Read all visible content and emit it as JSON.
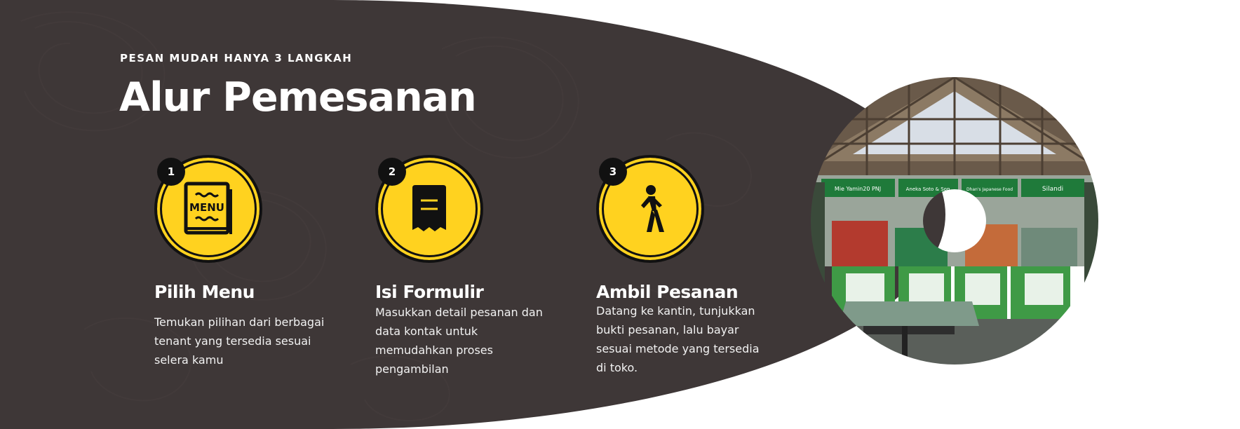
{
  "eyebrow": "PESAN MUDAH HANYA 3 LANGKAH",
  "title": "Alur Pemesanan",
  "colors": {
    "panel": "#3e3737",
    "accent": "#ffd21f",
    "ink": "#111111",
    "text": "#ffffff"
  },
  "steps": [
    {
      "number": "1",
      "icon": "menu-book-icon",
      "icon_text": "MENU",
      "title": "Pilih Menu",
      "description": "Temukan pilihan dari berbagai tenant yang tersedia sesuai selera kamu"
    },
    {
      "number": "2",
      "icon": "receipt-form-icon",
      "title": "Isi Formulir",
      "description": "Masukkan detail pesanan dan data kontak untuk memudahkan proses pengambilan"
    },
    {
      "number": "3",
      "icon": "walking-person-icon",
      "title": "Ambil Pesanan",
      "description": "Datang ke kantin, tunjukkan bukti pesanan, lalu bayar sesuai metode yang tersedia di toko."
    }
  ],
  "photo": {
    "subject": "canteen-interior-photo",
    "signs": [
      "Mie Yamin20 PNJ",
      "Aneka Soto & Sop",
      "Dhan's Japanese Food",
      "Silandi"
    ]
  }
}
